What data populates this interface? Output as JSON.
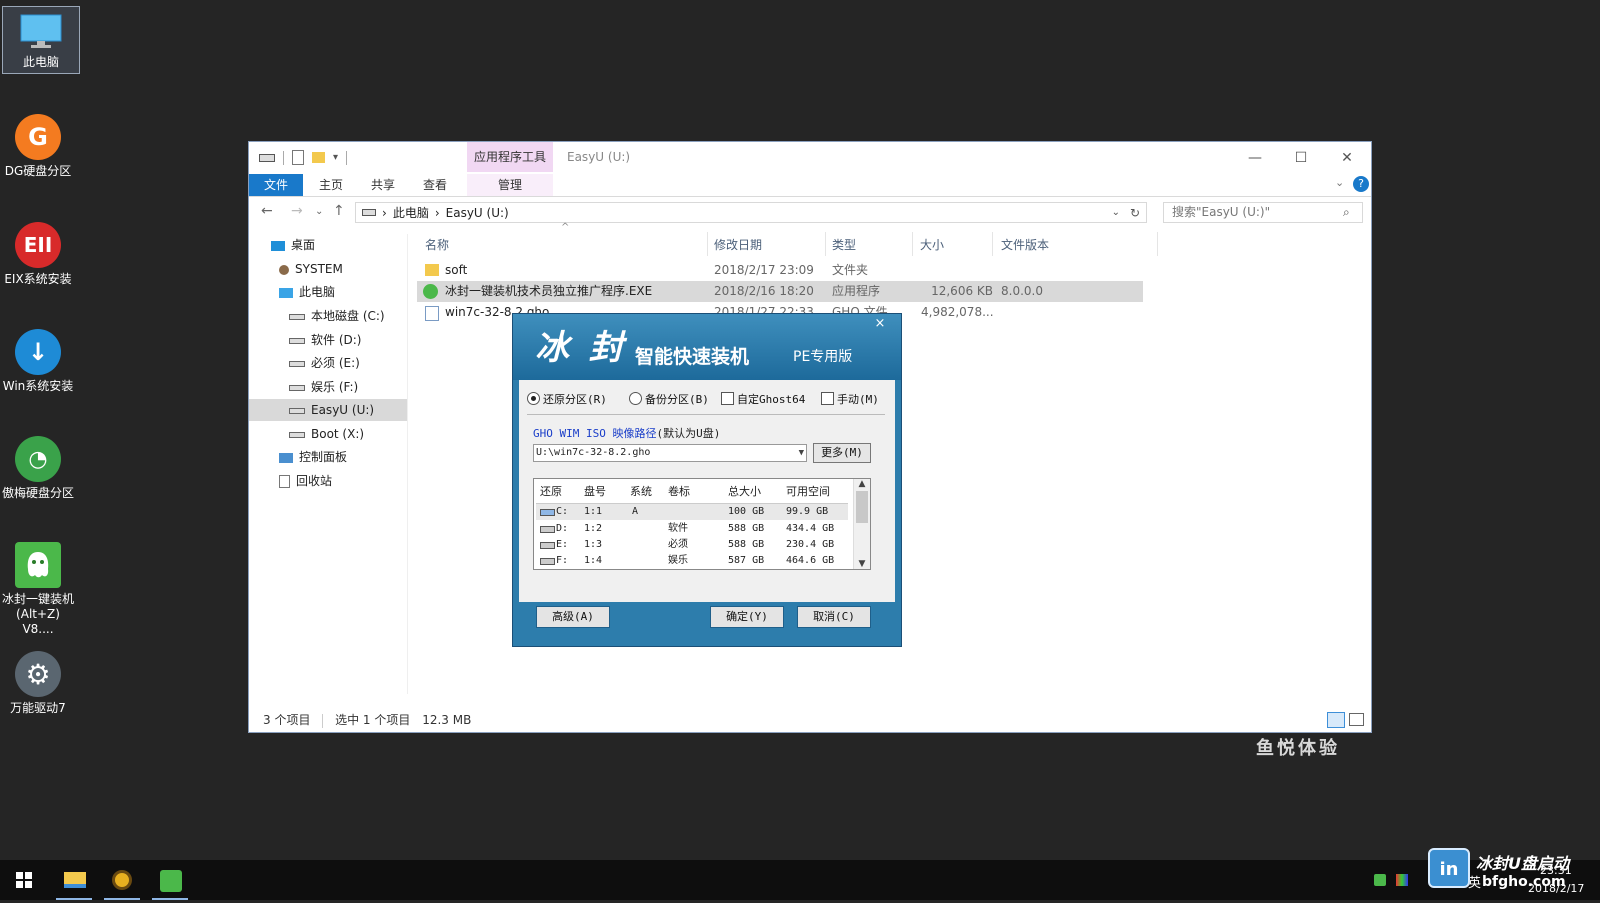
{
  "desktop": {
    "icons": [
      {
        "label": "此电脑"
      },
      {
        "label": "DG硬盘分区"
      },
      {
        "label": "EIX系统安装"
      },
      {
        "label": "Win系统安装"
      },
      {
        "label": "傲梅硬盘分区"
      },
      {
        "label": "冰封一键装机",
        "label2": "(Alt+Z) V8...."
      },
      {
        "label": "万能驱动7"
      }
    ]
  },
  "explorer": {
    "title": "EasyU (U:)",
    "context_tab": "应用程序工具",
    "ribbon_tabs": [
      "文件",
      "主页",
      "共享",
      "查看",
      "管理"
    ],
    "address": {
      "root": "此电脑",
      "current": "EasyU (U:)"
    },
    "search_placeholder": "搜索\"EasyU (U:)\"",
    "nav": [
      "桌面",
      "SYSTEM",
      "此电脑",
      "本地磁盘 (C:)",
      "软件 (D:)",
      "必须 (E:)",
      "娱乐 (F:)",
      "EasyU (U:)",
      "Boot (X:)",
      "控制面板",
      "回收站"
    ],
    "columns": [
      "名称",
      "修改日期",
      "类型",
      "大小",
      "文件版本"
    ],
    "files": [
      {
        "name": "soft",
        "date": "2018/2/17 23:09",
        "type": "文件夹",
        "size": "",
        "version": ""
      },
      {
        "name": "冰封一键装机技术员独立推广程序.EXE",
        "date": "2018/2/16 18:20",
        "type": "应用程序",
        "size": "12,606 KB",
        "version": "8.0.0.0"
      },
      {
        "name": "win7c-32-8.2.gho",
        "date": "2018/1/27 22:33",
        "type": "GHO 文件",
        "size": "4,982,078...",
        "version": ""
      }
    ],
    "status": {
      "count": "3 个项目",
      "selected": "选中 1 个项目",
      "size": "12.3 MB"
    }
  },
  "installer": {
    "logo": "冰 封",
    "subtitle": "智能快速装机",
    "edition": "PE专用版",
    "close": "×",
    "options": [
      "还原分区(R)",
      "备份分区(B)",
      "自定Ghost64",
      "手动(M)"
    ],
    "path_label_blue": "GHO WIM ISO 映像路径",
    "path_label_rest": "(默认为U盘)",
    "path_value": "U:\\win7c-32-8.2.gho",
    "more_button": "更多(M)",
    "table_headers": [
      "还原",
      "盘号",
      "系统",
      "卷标",
      "总大小",
      "可用空间"
    ],
    "table_rows": [
      {
        "drive": "C:",
        "num": "1:1",
        "sys": "A",
        "label": "",
        "total": "100 GB",
        "free": "99.9 GB"
      },
      {
        "drive": "D:",
        "num": "1:2",
        "sys": "",
        "label": "软件",
        "total": "588 GB",
        "free": "434.4 GB"
      },
      {
        "drive": "E:",
        "num": "1:3",
        "sys": "",
        "label": "必须",
        "total": "588 GB",
        "free": "230.4 GB"
      },
      {
        "drive": "F:",
        "num": "1:4",
        "sys": "",
        "label": "娱乐",
        "total": "587 GB",
        "free": "464.6 GB"
      }
    ],
    "buttons": {
      "advanced": "高级(A)",
      "ok": "确定(Y)",
      "cancel": "取消(C)"
    }
  },
  "watermark": "鱼悦体验",
  "brand": {
    "name": "冰封U盘启动",
    "url": "bfgho.com"
  },
  "clock": {
    "time": "23:31",
    "date": "2018/2/17",
    "lang": "英"
  }
}
